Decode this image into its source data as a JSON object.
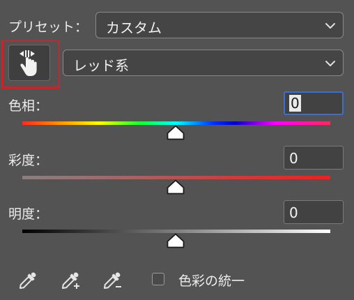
{
  "preset": {
    "label": "プリセット：",
    "value": "カスタム"
  },
  "range_dropdown": {
    "value": "レッド系"
  },
  "hue": {
    "label": "色相：",
    "value": "0"
  },
  "saturation": {
    "label": "彩度：",
    "value": "0"
  },
  "lightness": {
    "label": "明度：",
    "value": "0"
  },
  "colorize": {
    "label": "色彩の統一",
    "checked": false
  },
  "icons": {
    "target_adjust": "hand-target-adjust-icon",
    "eyedropper": "eyedropper-icon",
    "eyedropper_add": "eyedropper-plus-icon",
    "eyedropper_subtract": "eyedropper-minus-icon",
    "chevron": "chevron-down-icon"
  },
  "colors": {
    "panel_bg": "#535353",
    "focus_border": "#3b6fd6",
    "highlight_box": "#c4262b"
  }
}
